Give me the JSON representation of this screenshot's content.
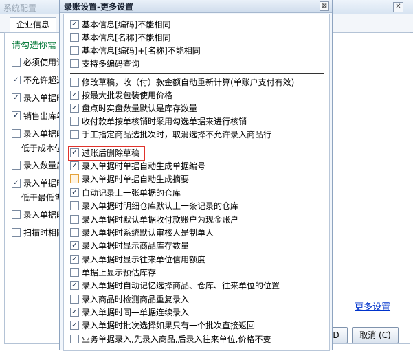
{
  "background_window": {
    "title": "系统配置",
    "tab": "企业信息",
    "prompt": "请勾选你需",
    "rows": [
      {
        "label": "必须使用证",
        "checked": false
      },
      {
        "label": "不允许超过",
        "checked": true
      },
      {
        "label": "录入单据时",
        "checked": true
      },
      {
        "label": "销售出库单",
        "checked": true
      },
      {
        "label": "录入单据时",
        "checked": false
      },
      {
        "label": "录入数量后",
        "checked": false
      },
      {
        "label": "录入单据时",
        "checked": true
      },
      {
        "label": "录入单据时",
        "checked": false
      },
      {
        "label": "扫描时相同",
        "checked": false
      }
    ],
    "sub_lines": [
      "低于成本位",
      "低于最低售"
    ],
    "more_settings_link": "更多设置",
    "cancel_button": "取消 (C)",
    "ok_button_fragment": "D"
  },
  "dialog": {
    "title": "录账设置-更多设置",
    "close_symbol": "⊠",
    "groups": [
      [
        {
          "label": "基本信息[编码]不能相同",
          "checked": true
        },
        {
          "label": "基本信息[名称]不能相同",
          "checked": false
        },
        {
          "label": "基本信息[编码]+[名称]不能相同",
          "checked": false
        },
        {
          "label": "支持多编码查询",
          "checked": false
        }
      ],
      [
        {
          "label": "修改草稿，收（付）款金额自动重新计算(单账户支付有效)",
          "checked": false
        },
        {
          "label": "按最大批发包装使用价格",
          "checked": true
        },
        {
          "label": "盘点时实盘数量默认是库存数量",
          "checked": true
        },
        {
          "label": "收付款单按单核销时采用勾选单据来进行核销",
          "checked": false
        },
        {
          "label": "手工指定商品选批次时，取消选择不允许录入商品行",
          "checked": false
        }
      ],
      [
        {
          "label": "过账后删除草稿",
          "checked": true,
          "highlighted": true
        },
        {
          "label": "录入单据时单据自动生成单据编号",
          "checked": true
        },
        {
          "label": "录入单据时单据自动生成摘要",
          "checked": false
        },
        {
          "label": "自动记录上一张单据的仓库",
          "checked": true
        },
        {
          "label": "录入单据时明细仓库默认上一条记录的仓库",
          "checked": false
        },
        {
          "label": "录入单据时默认单据收付款账户为现金账户",
          "checked": false
        },
        {
          "label": "录入单据时系统默认审核人是制单人",
          "checked": false
        },
        {
          "label": "录入单据时显示商品库存数量",
          "checked": true
        },
        {
          "label": "录入单据时显示往来单位信用额度",
          "checked": true
        },
        {
          "label": "单据上显示预估库存",
          "checked": false
        },
        {
          "label": "录入单据时自动记忆选择商品、仓库、往来单位的位置",
          "checked": true
        },
        {
          "label": "录入商品时检测商品重复录入",
          "checked": false
        },
        {
          "label": "录入单据时同一单据连续录入",
          "checked": true
        },
        {
          "label": "录入单据时批次选择如果只有一个批次直接返回",
          "checked": true
        },
        {
          "label": "业务单据录入,先录入商品,后录入往来单位,价格不变",
          "checked": false
        }
      ]
    ]
  }
}
